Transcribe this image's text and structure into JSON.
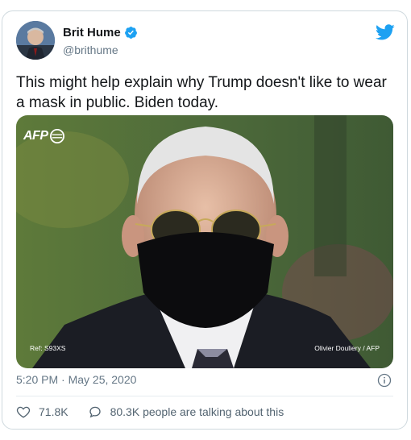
{
  "tweet": {
    "author_name": "Brit Hume",
    "author_handle": "@brithume",
    "text": "This might help explain why Trump doesn't like to wear a mask in public. Biden today.",
    "timestamp": "5:20 PM · May 25, 2020",
    "likes": "71.8K",
    "talking": "80.3K people are talking about this"
  },
  "media": {
    "agency_logo": "AFP",
    "ref_label": "Ref: S93XS",
    "credit": "Olivier Douliery / AFP"
  },
  "icons": {
    "verified": "verified-badge-icon",
    "brand": "twitter-bird-icon",
    "info": "info-icon",
    "like": "heart-icon",
    "reply": "speech-bubble-icon"
  },
  "colors": {
    "brand": "#1da1f2",
    "text": "#14171a",
    "secondary": "#657786"
  }
}
